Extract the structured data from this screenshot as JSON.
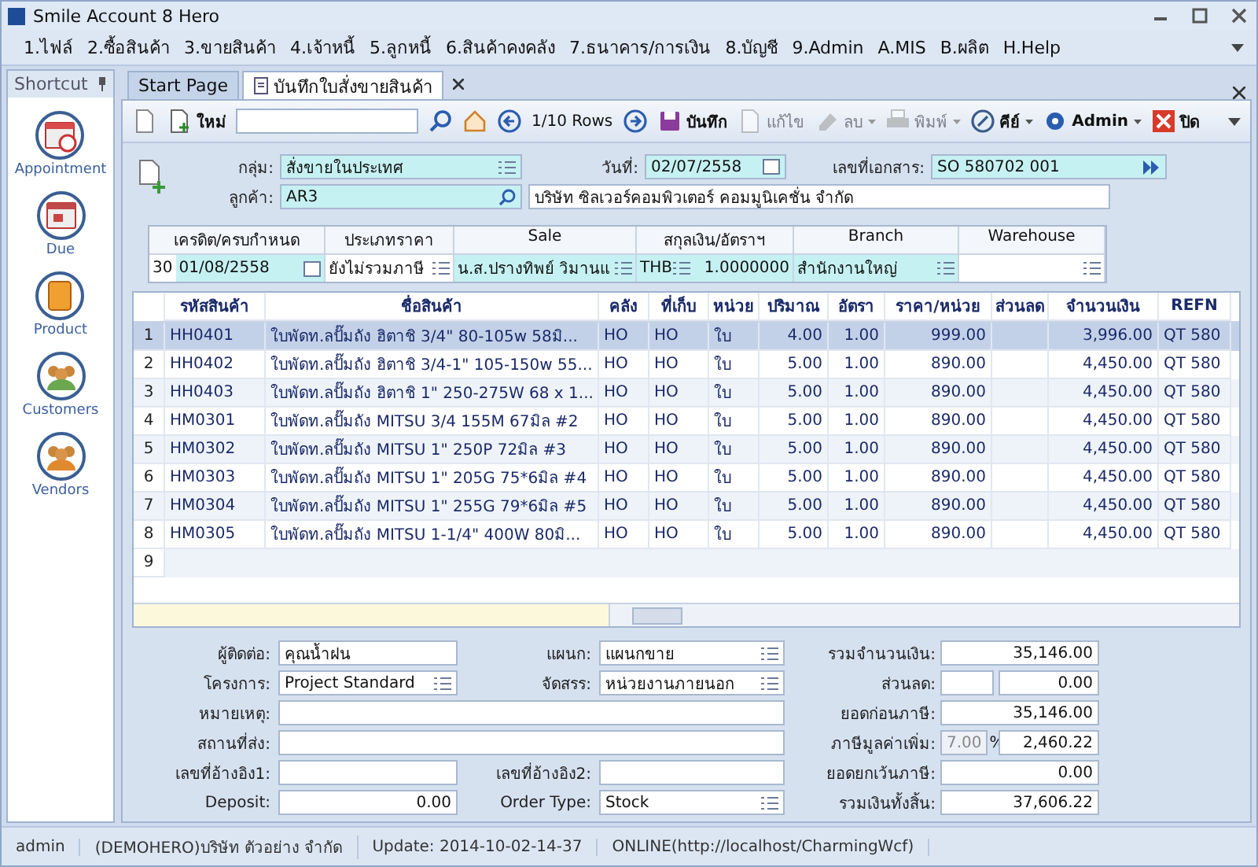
{
  "window": {
    "title": "Smile Account 8 Hero"
  },
  "menu": [
    "1.ไฟล์",
    "2.ซื้อสินค้า",
    "3.ขายสินค้า",
    "4.เจ้าหนี้",
    "5.ลูกหนี้",
    "6.สินค้าคงคลัง",
    "7.ธนาคาร/การเงิน",
    "8.บัญชี",
    "9.Admin",
    "A.MIS",
    "B.ผลิต",
    "H.Help"
  ],
  "shortcut": {
    "title": "Shortcut",
    "items": [
      {
        "label": "Appointment",
        "kind": "appointment"
      },
      {
        "label": "Due",
        "kind": "due"
      },
      {
        "label": "Product",
        "kind": "product"
      },
      {
        "label": "Customers",
        "kind": "customers"
      },
      {
        "label": "Vendors",
        "kind": "vendors"
      }
    ]
  },
  "tabs": [
    {
      "label": "Start Page",
      "selected": false
    },
    {
      "label": "บันทึกใบสั่งขายสินค้า",
      "selected": true
    }
  ],
  "toolbar": [
    {
      "kind": "copy",
      "disabled": false
    },
    {
      "kind": "new",
      "label": "ใหม่",
      "disabled": false
    },
    {
      "kind": "input"
    },
    {
      "kind": "search",
      "disabled": false
    },
    {
      "kind": "home",
      "disabled": false
    },
    {
      "kind": "prev",
      "disabled": false
    },
    {
      "kind": "text",
      "label": "1/10 Rows"
    },
    {
      "kind": "next",
      "disabled": false
    },
    {
      "kind": "save",
      "label": "บันทึก",
      "disabled": false
    },
    {
      "kind": "edit",
      "label": "แก้ไข",
      "disabled": true
    },
    {
      "kind": "delete",
      "label": "ลบ",
      "disabled": true,
      "dropdown": true
    },
    {
      "kind": "print",
      "label": "พิมพ์",
      "disabled": true,
      "dropdown": true
    },
    {
      "kind": "key",
      "label": "คีย์",
      "disabled": false,
      "dropdown": true
    },
    {
      "kind": "admin",
      "label": "Admin",
      "disabled": false,
      "dropdown": true
    },
    {
      "kind": "close",
      "label": "ปิด",
      "disabled": false
    }
  ],
  "header": {
    "group_label": "กลุ่ม:",
    "group": "สั่งขายในประเทศ",
    "date_label": "วันที่:",
    "date": "02/07/2558",
    "doc_label": "เลขที่เอกสาร:",
    "doc_no": "SO 580702 001",
    "customer_label": "ลูกค้า:",
    "customer_code": "AR3",
    "customer_name": "บริษัท ซิลเวอร์คอมพิวเตอร์ คอมมูนิเคชั่น จำกัด"
  },
  "terms": {
    "credit_header": "เครดิต/ครบกำหนด",
    "credit_days": "30",
    "due_date": "01/08/2558",
    "price_type_header": "ประเภทราคา",
    "price_type": "ยังไม่รวมภาษี",
    "sale_header": "Sale",
    "sale": "น.ส.ปรางทิพย์  วิมานแ",
    "currency_header": "สกุลเงิน/อัตราฯ",
    "currency": "THB",
    "rate": "1.0000000",
    "branch_header": "Branch",
    "branch": "สำนักงานใหญ่",
    "warehouse_header": "Warehouse"
  },
  "table": {
    "columns": [
      "รหัสสินค้า",
      "ชื่อสินค้า",
      "คลัง",
      "ที่เก็บ",
      "หน่วย",
      "ปริมาณ",
      "อัตรา",
      "ราคา/หน่วย",
      "ส่วนลด",
      "จำนวนเงิน",
      "REFN"
    ],
    "rows": [
      {
        "no": "1",
        "selected": true,
        "cells": [
          "HH0401",
          "ใบพัดท.ลปั๊มถัง ฮิตาชิ 3/4\" 80-105w 58มิ...",
          "HO",
          "HO",
          "ใบ",
          "4.00",
          "1.00",
          "999.00",
          "",
          "3,996.00",
          "QT 580"
        ]
      },
      {
        "no": "2",
        "selected": false,
        "cells": [
          "HH0402",
          "ใบพัดท.ลปั๊มถัง ฮิตาชิ 3/4-1\" 105-150w 55...",
          "HO",
          "HO",
          "ใบ",
          "5.00",
          "1.00",
          "890.00",
          "",
          "4,450.00",
          "QT 580"
        ]
      },
      {
        "no": "3",
        "selected": false,
        "cells": [
          "HH0403",
          "ใบพัดท.ลปั๊มถัง ฮิตาชิ 1\" 250-275W 68 x 1...",
          "HO",
          "HO",
          "ใบ",
          "5.00",
          "1.00",
          "890.00",
          "",
          "4,450.00",
          "QT 580"
        ]
      },
      {
        "no": "4",
        "selected": false,
        "cells": [
          "HM0301",
          "ใบพัดท.ลปั๊มถัง MITSU 3/4 155M 67มิล #2",
          "HO",
          "HO",
          "ใบ",
          "5.00",
          "1.00",
          "890.00",
          "",
          "4,450.00",
          "QT 580"
        ]
      },
      {
        "no": "5",
        "selected": false,
        "cells": [
          "HM0302",
          "ใบพัดท.ลปั๊มถัง MITSU 1\"  250P 72มิล #3",
          "HO",
          "HO",
          "ใบ",
          "5.00",
          "1.00",
          "890.00",
          "",
          "4,450.00",
          "QT 580"
        ]
      },
      {
        "no": "6",
        "selected": false,
        "cells": [
          "HM0303",
          "ใบพัดท.ลปั๊มถัง MITSU 1\" 205G 75*6มิล #4",
          "HO",
          "HO",
          "ใบ",
          "5.00",
          "1.00",
          "890.00",
          "",
          "4,450.00",
          "QT 580"
        ]
      },
      {
        "no": "7",
        "selected": false,
        "cells": [
          "HM0304",
          "ใบพัดท.ลปั๊มถัง MITSU 1\" 255G 79*6มิล #5",
          "HO",
          "HO",
          "ใบ",
          "5.00",
          "1.00",
          "890.00",
          "",
          "4,450.00",
          "QT 580"
        ]
      },
      {
        "no": "8",
        "selected": false,
        "cells": [
          "HM0305",
          "ใบพัดท.ลปั๊มถัง MITSU 1-1/4\" 400W 80มิ...",
          "HO",
          "HO",
          "ใบ",
          "5.00",
          "1.00",
          "890.00",
          "",
          "4,450.00",
          "QT 580"
        ]
      }
    ],
    "empty_rows": [
      "9"
    ]
  },
  "details": {
    "contact_label": "ผู้ติดต่อ:",
    "contact": "คุณน้ำฝน",
    "dept_label": "แผนก:",
    "dept": "แผนกขาย",
    "project_label": "โครงการ:",
    "project": "Project Standard",
    "alloc_label": "จัดสรร:",
    "alloc": "หน่วยงานภายนอก",
    "note_label": "หมายเหตุ:",
    "ship_label": "สถานที่ส่ง:",
    "ref1_label": "เลขที่อ้างอิง1:",
    "ref2_label": "เลขที่อ้างอิง2:",
    "deposit_label": "Deposit:",
    "deposit": "0.00",
    "order_type_label": "Order Type:",
    "order_type": "Stock"
  },
  "totals": {
    "sum_label": "รวมจำนวนเงิน:",
    "sum": "35,146.00",
    "discount_label": "ส่วนลด:",
    "discount": "0.00",
    "before_tax_label": "ยอดก่อนภาษี:",
    "before_tax": "35,146.00",
    "vat_label": "ภาษีมูลค่าเพิ่ม:",
    "vat_rate": "7.00",
    "vat_percent": "%",
    "vat": "2,460.22",
    "exempt_label": "ยอดยกเว้นภาษี:",
    "exempt": "0.00",
    "total_label": "รวมเงินทั้งสิ้น:",
    "total": "37,606.22"
  },
  "status_bar": [
    "admin",
    "(DEMOHERO)บริษัท ตัวอย่าง จำกัด",
    "Update: 2014-10-02-14-37",
    "ONLINE(http://localhost/CharmingWcf)"
  ]
}
